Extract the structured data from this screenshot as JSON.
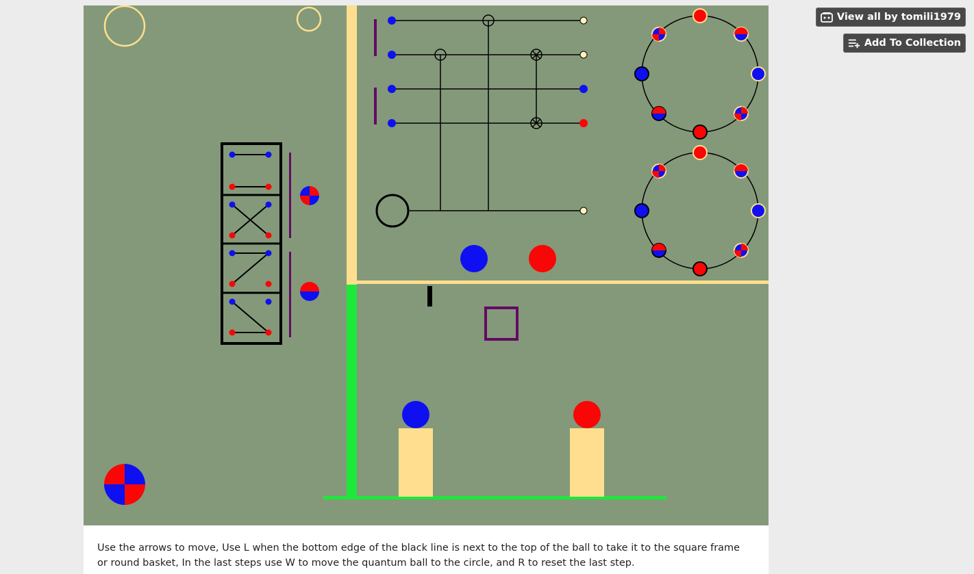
{
  "header": {
    "view_all_label": "View all by tomili1979",
    "add_collection_label": "Add To Collection"
  },
  "game": {
    "colors": {
      "background": "#84997a",
      "wall": "#ffdf8f",
      "green_wall": "#1ee83a",
      "blue": "#0e10f2",
      "red": "#fa0606",
      "purple": "#620a63",
      "pedestal": "#ffdf8f"
    }
  },
  "instructions": {
    "text": "Use the arrows to move,  Use L when the bottom edge of the black line is next to the top of the ball to take it to the square frame or round basket, In the last steps use W to move the quantum ball to the circle, and R to reset the last step."
  }
}
